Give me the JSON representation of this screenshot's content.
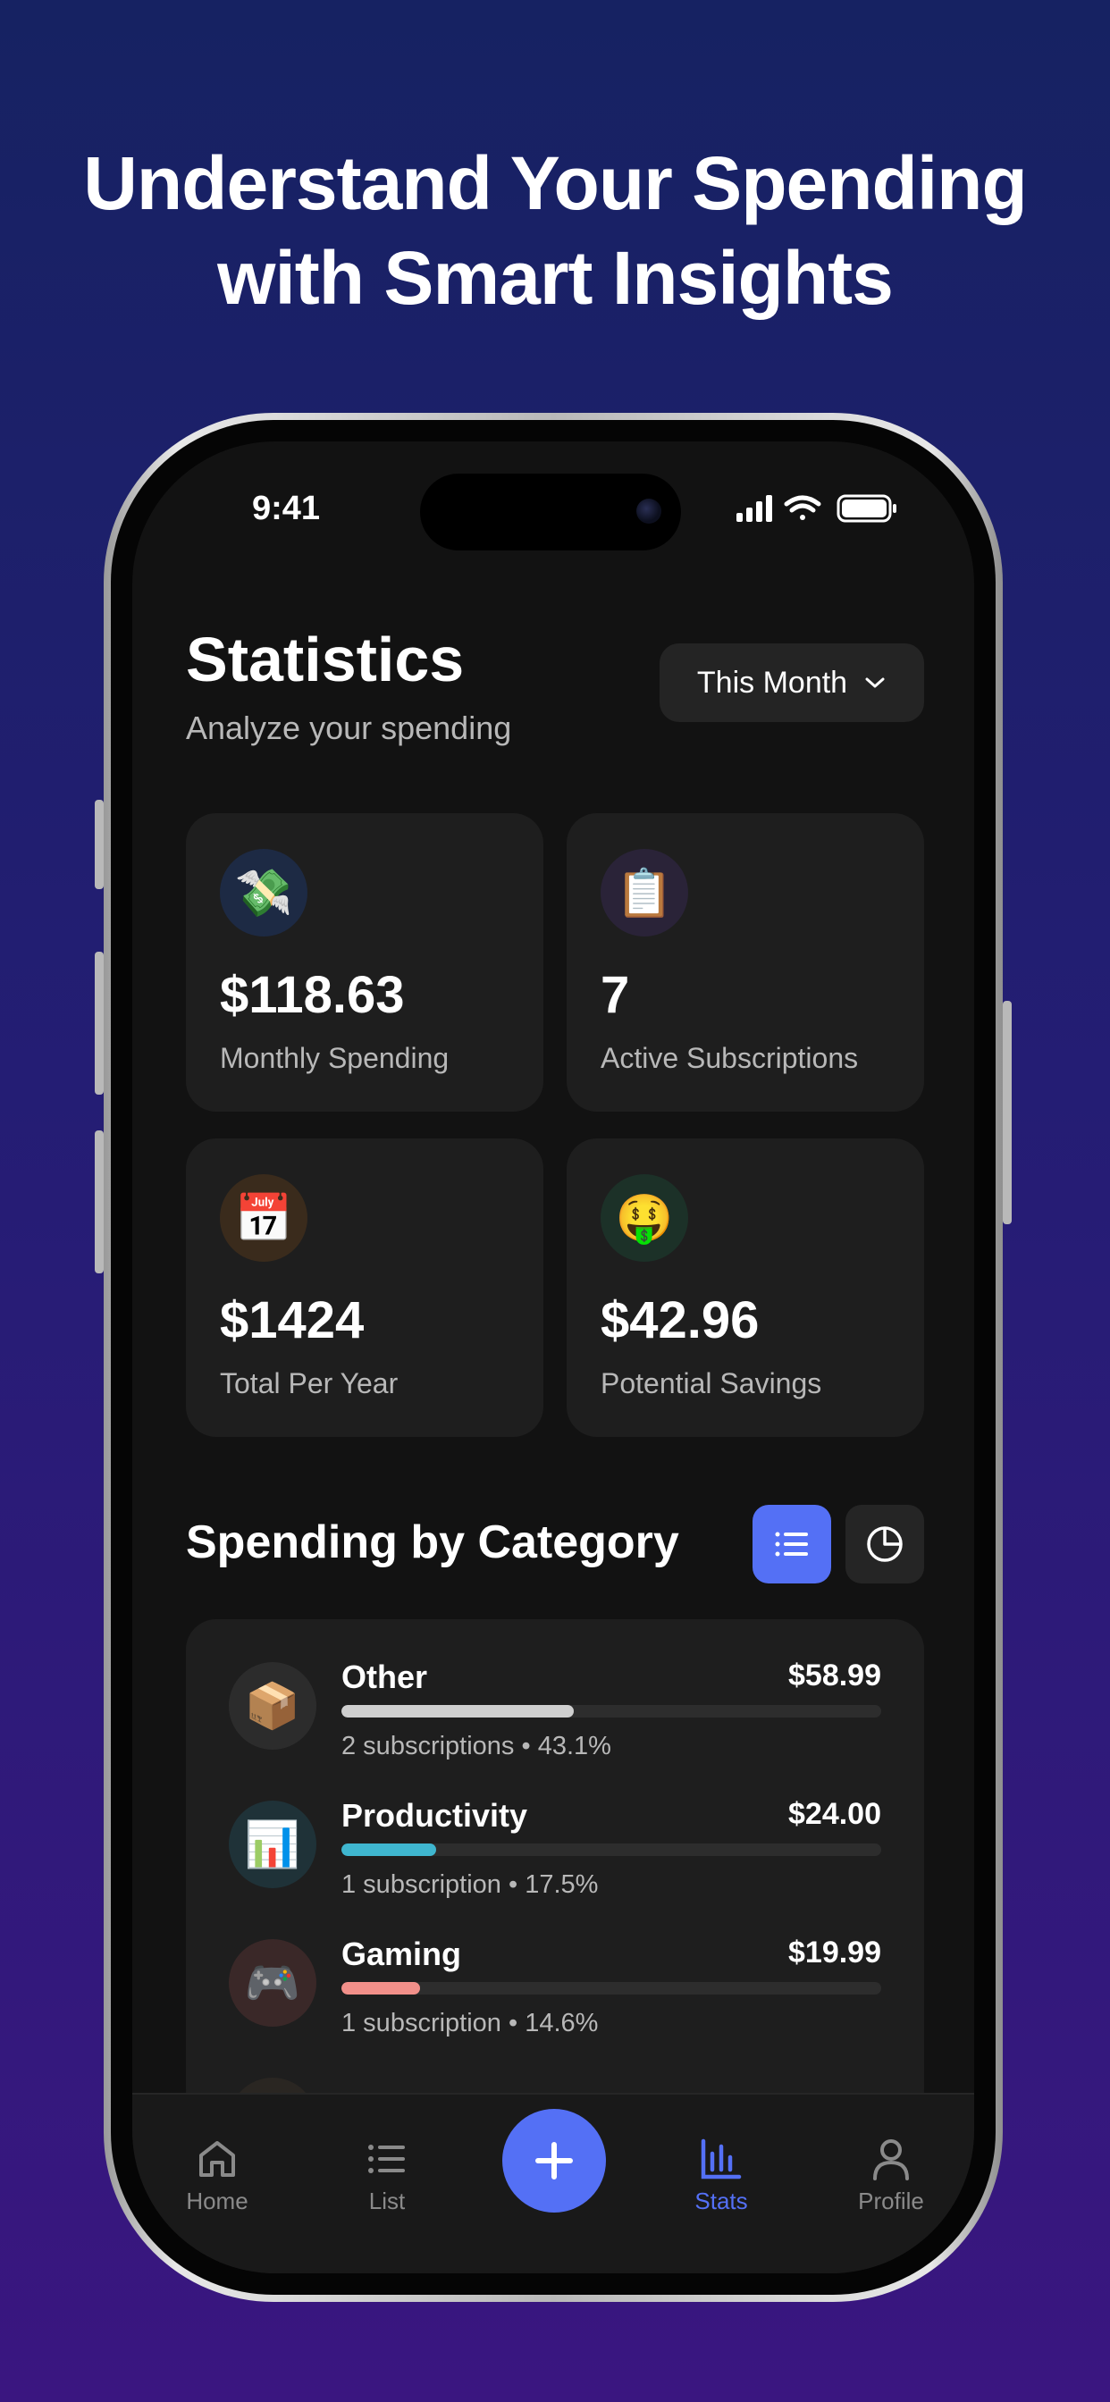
{
  "headline": {
    "line1": "Understand Your Spending",
    "line2": "with Smart Insights"
  },
  "status_bar": {
    "time": "9:41",
    "icons": [
      "cellular-signal-icon",
      "wifi-icon",
      "battery-icon"
    ]
  },
  "header": {
    "title": "Statistics",
    "subtitle": "Analyze your spending",
    "period_label": "This Month"
  },
  "stats": [
    {
      "value": "$118.63",
      "label": "Monthly Spending",
      "emoji": "💸",
      "icon": "money-wings-icon",
      "icon_bg": "#1d2a44"
    },
    {
      "value": "7",
      "label": "Active Subscriptions",
      "emoji": "📋",
      "icon": "clipboard-icon",
      "icon_bg": "#2a2338"
    },
    {
      "value": "$1424",
      "label": "Total Per Year",
      "emoji": "📅",
      "icon": "calendar-icon",
      "icon_bg": "#3a2b1c"
    },
    {
      "value": "$42.96",
      "label": "Potential Savings",
      "emoji": "🤑",
      "icon": "money-face-icon",
      "icon_bg": "#1c3128"
    }
  ],
  "category_section": {
    "title": "Spending by Category",
    "view_modes": [
      "list-view-icon",
      "pie-chart-icon"
    ],
    "active_view": "list"
  },
  "categories": [
    {
      "name": "Other",
      "amount": "$58.99",
      "meta": "2 subscriptions • 43.1%",
      "percent": 43.1,
      "color": "#cfcfcf",
      "emoji": "📦",
      "icon": "package-icon",
      "icon_bg": "#2c2c2c"
    },
    {
      "name": "Productivity",
      "amount": "$24.00",
      "meta": "1 subscription • 17.5%",
      "percent": 17.5,
      "color": "#3fb6cf",
      "emoji": "📊",
      "icon": "bar-chart-icon",
      "icon_bg": "#1f3238"
    },
    {
      "name": "Gaming",
      "amount": "$19.99",
      "meta": "1 subscription • 14.6%",
      "percent": 14.6,
      "color": "#f2908a",
      "emoji": "🎮",
      "icon": "game-controller-icon",
      "icon_bg": "#3a2828"
    }
  ],
  "tab_bar": {
    "home": "Home",
    "list": "List",
    "stats": "Stats",
    "profile": "Profile",
    "active": "stats"
  },
  "colors": {
    "accent": "#5470f5",
    "background": "#121212",
    "card": "#1e1e1e"
  }
}
